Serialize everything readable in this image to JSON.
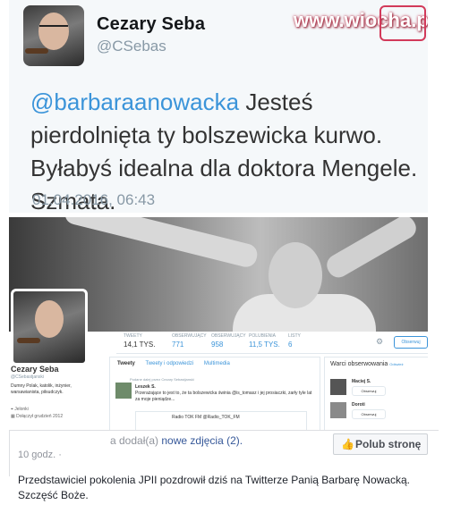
{
  "tweet": {
    "name": "Cezary Seba",
    "handle": "@CSebas",
    "mention": "@barbaraanowacka",
    "text": " Jesteś pierdolnięta ty bolszewicka kurwo. Byłabyś idealna dla doktora Mengele. Szmata.",
    "date": "01.04.2016, 06:43"
  },
  "watermark": "www.wiocha.pl",
  "profile": {
    "name": "Cezary Seba",
    "handle": "@CSebastjanski",
    "bio": "Dumny Polak, katolik, inżynier, warsawianista, piłsudczyk.",
    "location": "Jelonki",
    "joined": "Dołączył grudzień 2012",
    "stats": [
      {
        "label": "TWEETY",
        "value": "14,1 tys."
      },
      {
        "label": "OBSERWUJĄCY",
        "value": "771"
      },
      {
        "label": "OBSERWUJĄCY",
        "value": "958"
      },
      {
        "label": "POLUBIENIA",
        "value": "11,5 tys."
      },
      {
        "label": "LISTY",
        "value": "6"
      }
    ],
    "follow_label": "Obserwuj",
    "tabs": [
      "Tweety",
      "Tweety i odpowiedzi",
      "Multimedia"
    ],
    "feed": {
      "retweet_line": "Podane dalej przez Cezary Sebastjanski",
      "author": "Leszek S.",
      "text": "Przerażające to jest to, że ta bolszewicka świnia @is_tomasz i jej prosiaczki, zarły tyle lat za moje pieniądze...",
      "card": "Radio TOK FM @Radio_TOK_FM"
    },
    "who_to_follow": {
      "title": "Warci obserwowania",
      "refresh": "Odśwież",
      "items": [
        {
          "name": "Maciej S.",
          "button": "Obserwuj"
        },
        {
          "name": "Doroti",
          "button": "Obserwuj"
        }
      ]
    }
  },
  "fb": {
    "action_prefix": "a dodał(a) ",
    "action_link": "nowe zdjęcia (2).",
    "time": "10 godz. ·",
    "like_label": "Polub stronę",
    "text": "Przedstawiciel pokolenia JPII pozdrowił dziś na Twitterze Panią Barbarę Nowacką. Szczęść Boże."
  }
}
